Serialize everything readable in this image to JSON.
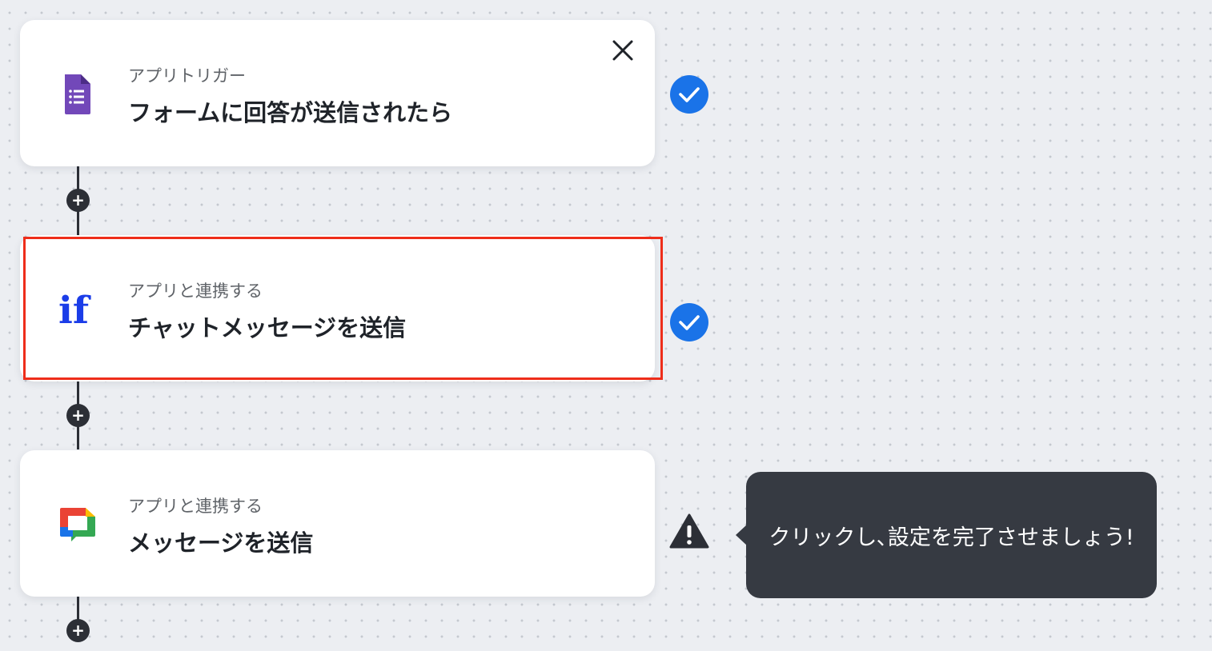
{
  "steps": [
    {
      "id": "trigger",
      "subtitle": "アプリトリガー",
      "title": "フォームに回答が送信されたら",
      "icon": "google-forms-icon",
      "status": "complete",
      "closable": true
    },
    {
      "id": "branch",
      "subtitle": "アプリと連携する",
      "title": "チャットメッセージを送信",
      "icon": "if-branch-icon",
      "status": "complete",
      "highlighted": true
    },
    {
      "id": "chat",
      "subtitle": "アプリと連携する",
      "title": "メッセージを送信",
      "icon": "google-chat-icon",
      "status": "warning"
    }
  ],
  "icons": {
    "close": "close-icon",
    "add": "plus-icon",
    "complete": "check-circle-icon",
    "warning": "warning-icon"
  },
  "tooltip": {
    "text": "クリックし､設定を完了させましょう!"
  },
  "colors": {
    "accent_blue": "#1a73e8",
    "highlight_red": "#ee2d1a",
    "tooltip_bg": "#363a42",
    "connector": "#2c2f36"
  }
}
